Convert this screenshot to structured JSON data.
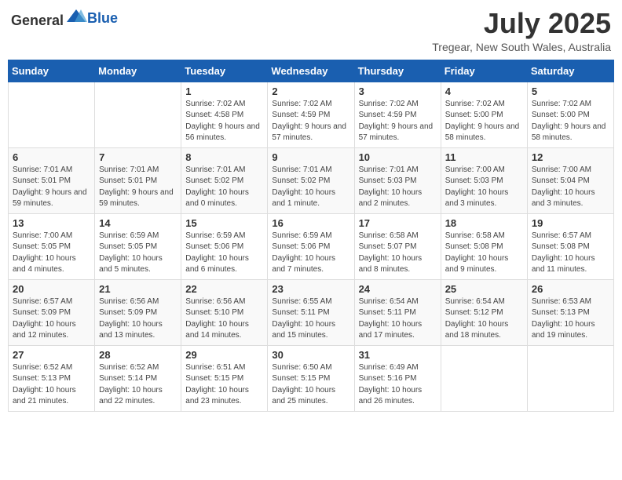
{
  "header": {
    "logo_general": "General",
    "logo_blue": "Blue",
    "month_year": "July 2025",
    "location": "Tregear, New South Wales, Australia"
  },
  "days_of_week": [
    "Sunday",
    "Monday",
    "Tuesday",
    "Wednesday",
    "Thursday",
    "Friday",
    "Saturday"
  ],
  "weeks": [
    [
      {
        "day": "",
        "info": ""
      },
      {
        "day": "",
        "info": ""
      },
      {
        "day": "1",
        "info": "Sunrise: 7:02 AM\nSunset: 4:58 PM\nDaylight: 9 hours and 56 minutes."
      },
      {
        "day": "2",
        "info": "Sunrise: 7:02 AM\nSunset: 4:59 PM\nDaylight: 9 hours and 57 minutes."
      },
      {
        "day": "3",
        "info": "Sunrise: 7:02 AM\nSunset: 4:59 PM\nDaylight: 9 hours and 57 minutes."
      },
      {
        "day": "4",
        "info": "Sunrise: 7:02 AM\nSunset: 5:00 PM\nDaylight: 9 hours and 58 minutes."
      },
      {
        "day": "5",
        "info": "Sunrise: 7:02 AM\nSunset: 5:00 PM\nDaylight: 9 hours and 58 minutes."
      }
    ],
    [
      {
        "day": "6",
        "info": "Sunrise: 7:01 AM\nSunset: 5:01 PM\nDaylight: 9 hours and 59 minutes."
      },
      {
        "day": "7",
        "info": "Sunrise: 7:01 AM\nSunset: 5:01 PM\nDaylight: 9 hours and 59 minutes."
      },
      {
        "day": "8",
        "info": "Sunrise: 7:01 AM\nSunset: 5:02 PM\nDaylight: 10 hours and 0 minutes."
      },
      {
        "day": "9",
        "info": "Sunrise: 7:01 AM\nSunset: 5:02 PM\nDaylight: 10 hours and 1 minute."
      },
      {
        "day": "10",
        "info": "Sunrise: 7:01 AM\nSunset: 5:03 PM\nDaylight: 10 hours and 2 minutes."
      },
      {
        "day": "11",
        "info": "Sunrise: 7:00 AM\nSunset: 5:03 PM\nDaylight: 10 hours and 3 minutes."
      },
      {
        "day": "12",
        "info": "Sunrise: 7:00 AM\nSunset: 5:04 PM\nDaylight: 10 hours and 3 minutes."
      }
    ],
    [
      {
        "day": "13",
        "info": "Sunrise: 7:00 AM\nSunset: 5:05 PM\nDaylight: 10 hours and 4 minutes."
      },
      {
        "day": "14",
        "info": "Sunrise: 6:59 AM\nSunset: 5:05 PM\nDaylight: 10 hours and 5 minutes."
      },
      {
        "day": "15",
        "info": "Sunrise: 6:59 AM\nSunset: 5:06 PM\nDaylight: 10 hours and 6 minutes."
      },
      {
        "day": "16",
        "info": "Sunrise: 6:59 AM\nSunset: 5:06 PM\nDaylight: 10 hours and 7 minutes."
      },
      {
        "day": "17",
        "info": "Sunrise: 6:58 AM\nSunset: 5:07 PM\nDaylight: 10 hours and 8 minutes."
      },
      {
        "day": "18",
        "info": "Sunrise: 6:58 AM\nSunset: 5:08 PM\nDaylight: 10 hours and 9 minutes."
      },
      {
        "day": "19",
        "info": "Sunrise: 6:57 AM\nSunset: 5:08 PM\nDaylight: 10 hours and 11 minutes."
      }
    ],
    [
      {
        "day": "20",
        "info": "Sunrise: 6:57 AM\nSunset: 5:09 PM\nDaylight: 10 hours and 12 minutes."
      },
      {
        "day": "21",
        "info": "Sunrise: 6:56 AM\nSunset: 5:09 PM\nDaylight: 10 hours and 13 minutes."
      },
      {
        "day": "22",
        "info": "Sunrise: 6:56 AM\nSunset: 5:10 PM\nDaylight: 10 hours and 14 minutes."
      },
      {
        "day": "23",
        "info": "Sunrise: 6:55 AM\nSunset: 5:11 PM\nDaylight: 10 hours and 15 minutes."
      },
      {
        "day": "24",
        "info": "Sunrise: 6:54 AM\nSunset: 5:11 PM\nDaylight: 10 hours and 17 minutes."
      },
      {
        "day": "25",
        "info": "Sunrise: 6:54 AM\nSunset: 5:12 PM\nDaylight: 10 hours and 18 minutes."
      },
      {
        "day": "26",
        "info": "Sunrise: 6:53 AM\nSunset: 5:13 PM\nDaylight: 10 hours and 19 minutes."
      }
    ],
    [
      {
        "day": "27",
        "info": "Sunrise: 6:52 AM\nSunset: 5:13 PM\nDaylight: 10 hours and 21 minutes."
      },
      {
        "day": "28",
        "info": "Sunrise: 6:52 AM\nSunset: 5:14 PM\nDaylight: 10 hours and 22 minutes."
      },
      {
        "day": "29",
        "info": "Sunrise: 6:51 AM\nSunset: 5:15 PM\nDaylight: 10 hours and 23 minutes."
      },
      {
        "day": "30",
        "info": "Sunrise: 6:50 AM\nSunset: 5:15 PM\nDaylight: 10 hours and 25 minutes."
      },
      {
        "day": "31",
        "info": "Sunrise: 6:49 AM\nSunset: 5:16 PM\nDaylight: 10 hours and 26 minutes."
      },
      {
        "day": "",
        "info": ""
      },
      {
        "day": "",
        "info": ""
      }
    ]
  ]
}
